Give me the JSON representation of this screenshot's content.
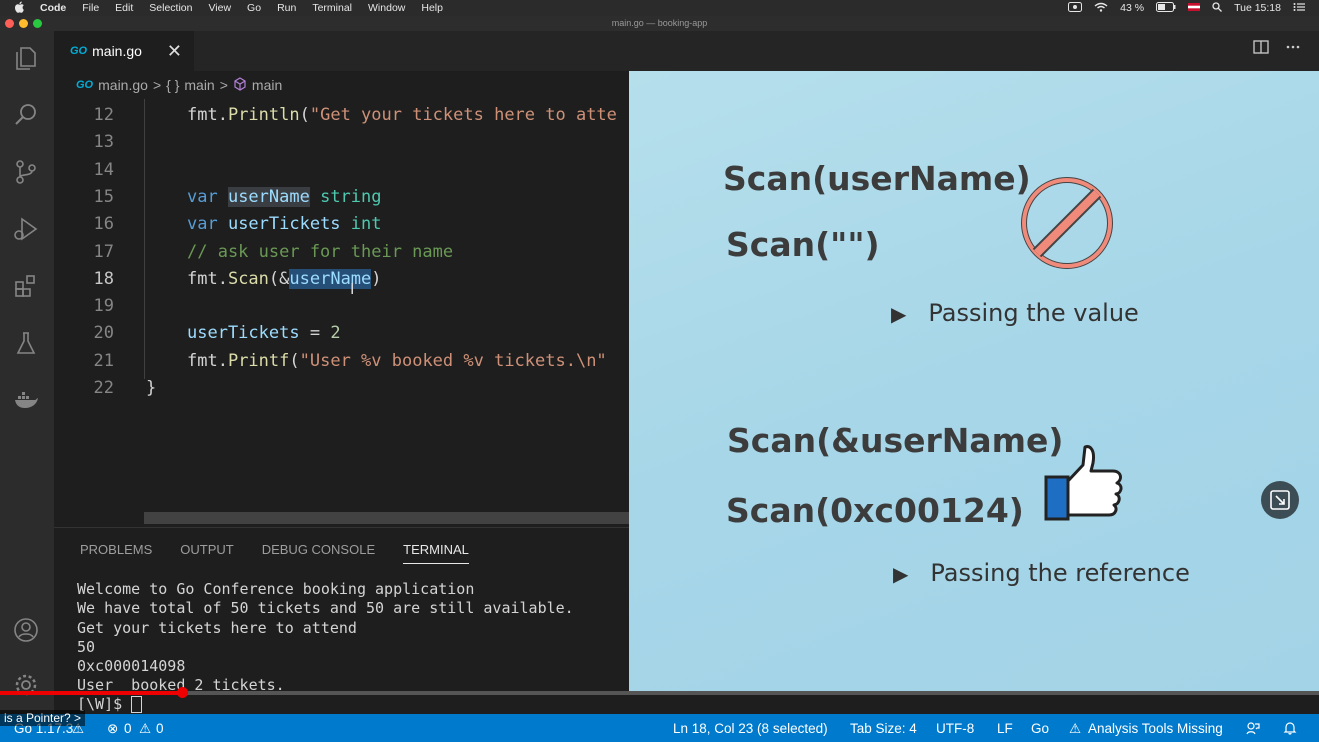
{
  "menubar": {
    "apple": "",
    "app": "Code",
    "items": [
      "File",
      "Edit",
      "Selection",
      "View",
      "Go",
      "Run",
      "Terminal",
      "Window",
      "Help"
    ],
    "battery": "43 %",
    "clock": "Tue 15:18"
  },
  "window": {
    "title": "main.go — booking-app"
  },
  "tab": {
    "badge": "GO",
    "label": "main.go",
    "close": "✕"
  },
  "breadcrumb": {
    "badge": "GO",
    "file": "main.go",
    "sep1": ">",
    "func_icon": "{ }",
    "func": "main",
    "sep2": ">",
    "symbol": "main"
  },
  "editor": {
    "lines": [
      {
        "n": "12",
        "tokens": [
          [
            "pl",
            "fmt."
          ],
          [
            "fn",
            "Println"
          ],
          [
            "pl",
            "("
          ],
          [
            "str",
            "\"Get your tickets here to atte"
          ]
        ]
      },
      {
        "n": "13",
        "tokens": []
      },
      {
        "n": "14",
        "tokens": []
      },
      {
        "n": "15",
        "tokens": [
          [
            "kw",
            "var "
          ],
          [
            "var hl2",
            "userName"
          ],
          [
            "ty",
            " string"
          ]
        ]
      },
      {
        "n": "16",
        "tokens": [
          [
            "kw",
            "var "
          ],
          [
            "var",
            "userTickets"
          ],
          [
            "ty",
            " int"
          ]
        ]
      },
      {
        "n": "17",
        "tokens": [
          [
            "cm",
            "// ask user for their name"
          ]
        ]
      },
      {
        "n": "18",
        "tokens": [
          [
            "pl",
            "fmt."
          ],
          [
            "fn",
            "Scan"
          ],
          [
            "pl",
            "(&"
          ],
          [
            "var hl",
            "userName"
          ],
          [
            "pl",
            ")"
          ]
        ]
      },
      {
        "n": "19",
        "tokens": []
      },
      {
        "n": "20",
        "tokens": [
          [
            "var",
            "userTickets"
          ],
          [
            "pl",
            " = "
          ],
          [
            "num",
            "2"
          ]
        ]
      },
      {
        "n": "21",
        "tokens": [
          [
            "pl",
            "fmt."
          ],
          [
            "fn",
            "Printf"
          ],
          [
            "pl",
            "("
          ],
          [
            "str",
            "\"User %v booked %v tickets.\\n\""
          ]
        ]
      },
      {
        "n": "22",
        "tokens": [
          [
            "pl",
            "}"
          ]
        ]
      }
    ]
  },
  "panel": {
    "tabs": [
      "PROBLEMS",
      "OUTPUT",
      "DEBUG CONSOLE",
      "TERMINAL"
    ],
    "active_tab": "TERMINAL",
    "terminal_lines": [
      "Welcome to Go Conference booking application",
      "We have total of 50 tickets and 50 are still available.",
      "Get your tickets here to attend",
      "50",
      "0xc000014098",
      "User  booked 2 tickets."
    ],
    "prompt": "[\\W]$ "
  },
  "slide": {
    "line1": "Scan(userName)",
    "line2": "Scan(\"\")",
    "bullet1": "Passing the value",
    "line3": "Scan(&userName)",
    "line4": "Scan(0xc00124)",
    "bullet2": "Passing the reference",
    "bullet_glyph": "▶"
  },
  "video": {
    "progress": 0.139,
    "chapter": "is a Pointer?",
    "chapter_chevron": ">"
  },
  "statusbar": {
    "go_version": "Go 1.17.3",
    "errors": "0",
    "warnings": "0",
    "position": "Ln 18, Col 23 (8 selected)",
    "tab_size": "Tab Size: 4",
    "encoding": "UTF-8",
    "eol": "LF",
    "language": "Go",
    "analysis": "Analysis Tools Missing"
  },
  "colors": {
    "accent": "#007acc",
    "progress": "#ee0000",
    "slide_bg": "#a6d6e8"
  }
}
